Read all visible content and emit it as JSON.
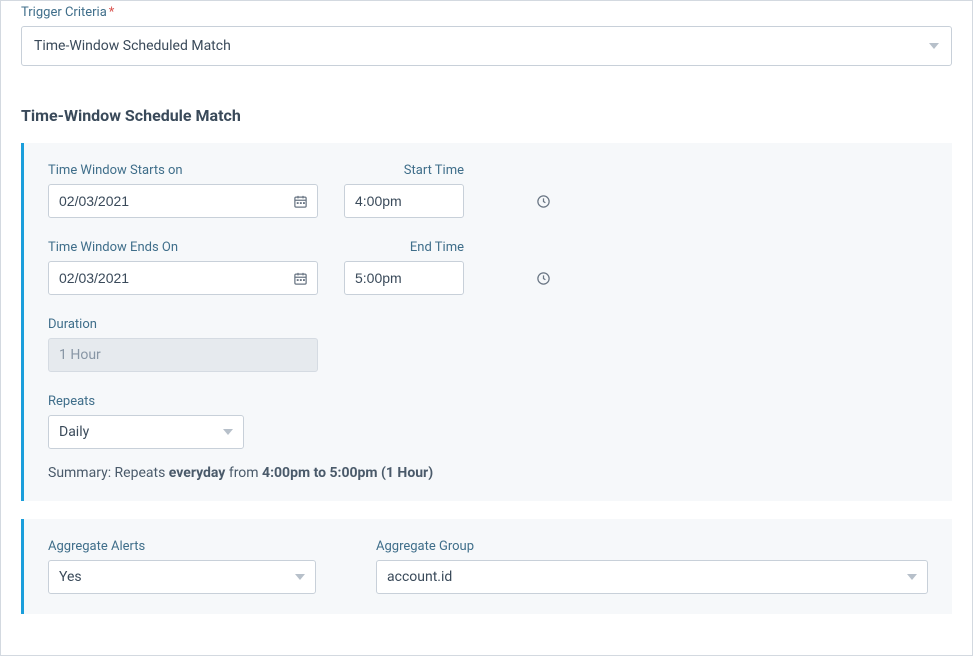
{
  "triggerCriteria": {
    "label": "Trigger Criteria",
    "value": "Time-Window Scheduled Match"
  },
  "sectionTitle": "Time-Window Schedule Match",
  "schedule": {
    "startDateLabel": "Time Window Starts on",
    "startDate": "02/03/2021",
    "startTimeLabel": "Start Time",
    "startTime": "4:00pm",
    "endDateLabel": "Time Window Ends On",
    "endDate": "02/03/2021",
    "endTimeLabel": "End Time",
    "endTime": "5:00pm",
    "durationLabel": "Duration",
    "duration": "1 Hour",
    "repeatsLabel": "Repeats",
    "repeats": "Daily",
    "summaryPrefix": "Summary: Repeats ",
    "summaryEveryday": "everyday",
    "summaryMid": " from ",
    "summaryRange": "4:00pm to 5:00pm (1 Hour)"
  },
  "aggregate": {
    "alertsLabel": "Aggregate Alerts",
    "alertsValue": "Yes",
    "groupLabel": "Aggregate Group",
    "groupValue": "account.id"
  }
}
